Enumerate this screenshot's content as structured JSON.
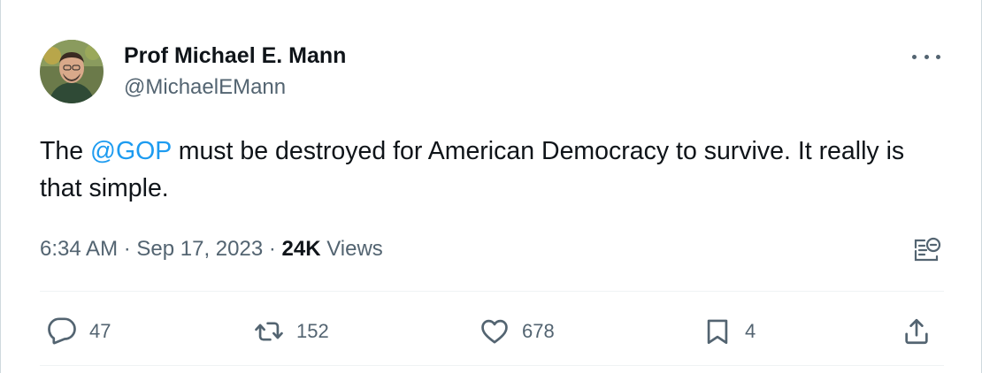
{
  "author": {
    "display_name": "Prof Michael E. Mann",
    "handle": "@MichaelEMann"
  },
  "tweet": {
    "text_before": "The ",
    "mention": "@GOP",
    "text_after": " must be destroyed for American Democracy to survive. It really is that simple."
  },
  "meta": {
    "time": "6:34 AM",
    "separator1": " · ",
    "date": "Sep 17, 2023",
    "separator2": " · ",
    "views_count": "24K",
    "views_label": " Views"
  },
  "actions": {
    "replies": "47",
    "retweets": "152",
    "likes": "678",
    "bookmarks": "4"
  },
  "icons": {
    "reply": "speech-bubble-icon",
    "retweet": "retweet-arrows-icon",
    "like": "heart-icon",
    "bookmark": "bookmark-icon",
    "share": "share-upload-icon",
    "more": "ellipsis-icon",
    "grok": "analyze-post-icon"
  },
  "colors": {
    "accent": "#1d9bf0",
    "text": "#0f1419",
    "secondary": "#536471"
  }
}
